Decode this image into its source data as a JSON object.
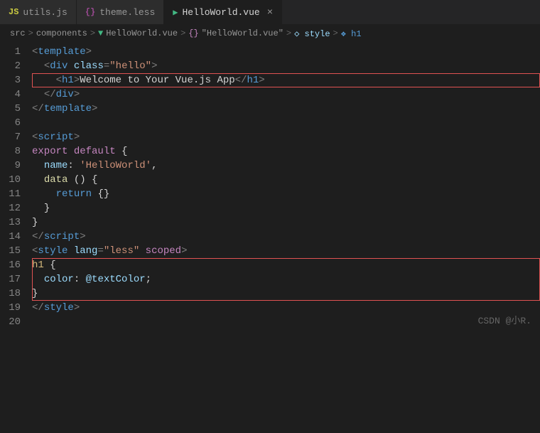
{
  "tabs": [
    {
      "id": "utils",
      "icon": "JS",
      "icon_class": "js",
      "label": "utils.js",
      "active": false,
      "show_close": false
    },
    {
      "id": "theme",
      "icon": "{}",
      "icon_class": "less",
      "label": "theme.less",
      "active": false,
      "show_close": false
    },
    {
      "id": "helloworld",
      "icon": "V",
      "icon_class": "vue",
      "label": "HelloWorld.vue",
      "active": true,
      "show_close": true
    }
  ],
  "breadcrumb": {
    "parts": [
      "src",
      ">",
      "components",
      ">",
      "HelloWorld.vue",
      ">",
      "{}",
      "\"HelloWorld.vue\"",
      ">",
      "style",
      ">",
      "h1"
    ]
  },
  "lines": [
    {
      "num": 1,
      "tokens": [
        {
          "t": "tag",
          "v": "<"
        },
        {
          "t": "tag-name",
          "v": "template"
        },
        {
          "t": "tag",
          "v": ">"
        }
      ]
    },
    {
      "num": 2,
      "tokens": [
        {
          "t": "punct",
          "v": "  "
        },
        {
          "t": "tag",
          "v": "<"
        },
        {
          "t": "tag-name",
          "v": "div"
        },
        {
          "t": "punct",
          "v": " "
        },
        {
          "t": "attr-name",
          "v": "class"
        },
        {
          "t": "tag",
          "v": "="
        },
        {
          "t": "attr-value",
          "v": "\"hello\""
        },
        {
          "t": "tag",
          "v": ">"
        }
      ]
    },
    {
      "num": 3,
      "highlight": true,
      "tokens": [
        {
          "t": "punct",
          "v": "    "
        },
        {
          "t": "tag",
          "v": "<"
        },
        {
          "t": "tag-name",
          "v": "h1"
        },
        {
          "t": "tag",
          "v": ">"
        },
        {
          "t": "text-content",
          "v": "Welcome to Your Vue.js App"
        },
        {
          "t": "tag",
          "v": "</"
        },
        {
          "t": "tag-name",
          "v": "h1"
        },
        {
          "t": "tag",
          "v": ">"
        }
      ]
    },
    {
      "num": 4,
      "tokens": [
        {
          "t": "punct",
          "v": "  "
        },
        {
          "t": "tag",
          "v": "</"
        },
        {
          "t": "tag-name",
          "v": "div"
        },
        {
          "t": "tag",
          "v": ">"
        }
      ]
    },
    {
      "num": 5,
      "tokens": [
        {
          "t": "tag",
          "v": "</"
        },
        {
          "t": "tag-name",
          "v": "template"
        },
        {
          "t": "tag",
          "v": ">"
        }
      ]
    },
    {
      "num": 6,
      "tokens": []
    },
    {
      "num": 7,
      "tokens": [
        {
          "t": "tag",
          "v": "<"
        },
        {
          "t": "tag-name",
          "v": "script"
        },
        {
          "t": "tag",
          "v": ">"
        }
      ]
    },
    {
      "num": 8,
      "tokens": [
        {
          "t": "keyword",
          "v": "export"
        },
        {
          "t": "punct",
          "v": " "
        },
        {
          "t": "keyword",
          "v": "default"
        },
        {
          "t": "punct",
          "v": " {"
        }
      ]
    },
    {
      "num": 9,
      "tokens": [
        {
          "t": "punct",
          "v": "  "
        },
        {
          "t": "var-name",
          "v": "name"
        },
        {
          "t": "punct",
          "v": ": "
        },
        {
          "t": "string",
          "v": "'HelloWorld'"
        },
        {
          "t": "punct",
          "v": ","
        }
      ]
    },
    {
      "num": 10,
      "tokens": [
        {
          "t": "punct",
          "v": "  "
        },
        {
          "t": "func-name",
          "v": "data"
        },
        {
          "t": "punct",
          "v": " () {"
        }
      ]
    },
    {
      "num": 11,
      "tokens": [
        {
          "t": "punct",
          "v": "    "
        },
        {
          "t": "keyword-blue",
          "v": "return"
        },
        {
          "t": "punct",
          "v": " {}"
        }
      ]
    },
    {
      "num": 12,
      "tokens": [
        {
          "t": "punct",
          "v": "  }"
        }
      ]
    },
    {
      "num": 13,
      "tokens": [
        {
          "t": "punct",
          "v": "}"
        }
      ]
    },
    {
      "num": 14,
      "tokens": [
        {
          "t": "tag",
          "v": "</"
        },
        {
          "t": "tag-name",
          "v": "script"
        },
        {
          "t": "tag",
          "v": ">"
        }
      ]
    },
    {
      "num": 15,
      "tokens": [
        {
          "t": "tag",
          "v": "<"
        },
        {
          "t": "tag-name",
          "v": "style"
        },
        {
          "t": "punct",
          "v": " "
        },
        {
          "t": "attr-name",
          "v": "lang"
        },
        {
          "t": "tag",
          "v": "="
        },
        {
          "t": "attr-value",
          "v": "\"less\""
        },
        {
          "t": "punct",
          "v": " "
        },
        {
          "t": "keyword",
          "v": "scoped"
        },
        {
          "t": "tag",
          "v": ">"
        }
      ]
    },
    {
      "num": 16,
      "highlight_block": true,
      "tokens": [
        {
          "t": "css-selector",
          "v": "h1"
        },
        {
          "t": "punct",
          "v": " {"
        }
      ]
    },
    {
      "num": 17,
      "highlight_block": true,
      "tokens": [
        {
          "t": "punct",
          "v": "  "
        },
        {
          "t": "css-prop",
          "v": "color"
        },
        {
          "t": "punct",
          "v": ": "
        },
        {
          "t": "css-at",
          "v": "@textColor"
        },
        {
          "t": "punct",
          "v": ";"
        }
      ]
    },
    {
      "num": 18,
      "highlight_block": true,
      "tokens": [
        {
          "t": "punct",
          "v": "}"
        }
      ]
    },
    {
      "num": 19,
      "tokens": [
        {
          "t": "tag",
          "v": "</"
        },
        {
          "t": "tag-name",
          "v": "style"
        },
        {
          "t": "tag",
          "v": ">"
        }
      ]
    },
    {
      "num": 20,
      "tokens": []
    }
  ],
  "watermark": "CSDN @小R."
}
